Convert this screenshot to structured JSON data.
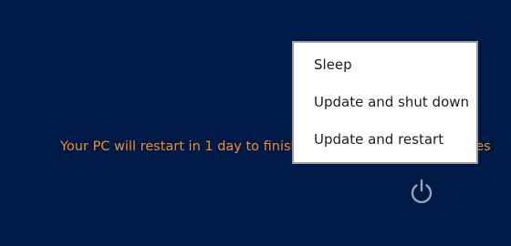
{
  "notice": {
    "text": "Your PC will restart in 1 day to finish installing important updates"
  },
  "power_menu": {
    "items": [
      {
        "label": "Sleep"
      },
      {
        "label": "Update and shut down"
      },
      {
        "label": "Update and restart"
      }
    ]
  },
  "power_button": {
    "icon": "power-icon"
  },
  "colors": {
    "background": "#001a48",
    "notice_text": "#f08a2e",
    "menu_background": "#ffffff",
    "menu_border": "#9e9e9e",
    "menu_text": "#1c1c1c",
    "power_icon": "#9aa3b5"
  }
}
